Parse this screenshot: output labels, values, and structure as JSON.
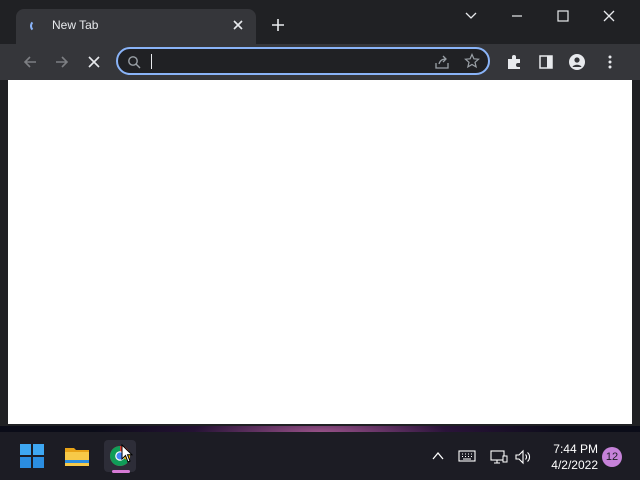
{
  "browser": {
    "tab": {
      "title": "New Tab"
    },
    "omnibox": {
      "value": "",
      "placeholder": ""
    }
  },
  "taskbar": {
    "time": "7:44 PM",
    "date": "4/2/2022",
    "notification_count": "12"
  },
  "colors": {
    "accent": "#8ab4f8",
    "chrome_dark": "#202124",
    "toolbar": "#35363a",
    "taskbar": "#1c1c24",
    "notification": "#c682d9"
  },
  "icons": {
    "tab": [
      "loading-spinner-icon",
      "close-icon",
      "plus-icon"
    ],
    "window": [
      "chevron-down-icon",
      "minimize-icon",
      "maximize-icon",
      "close-icon"
    ],
    "toolbar": [
      "back-arrow-icon",
      "forward-arrow-icon",
      "stop-icon",
      "search-icon",
      "share-icon",
      "star-icon",
      "extensions-icon",
      "side-panel-icon",
      "profile-icon",
      "kebab-menu-icon"
    ],
    "taskbar": [
      "windows-start-icon",
      "file-explorer-icon",
      "chrome-icon",
      "chevron-up-icon",
      "keyboard-icon",
      "network-icon",
      "speaker-icon"
    ]
  }
}
